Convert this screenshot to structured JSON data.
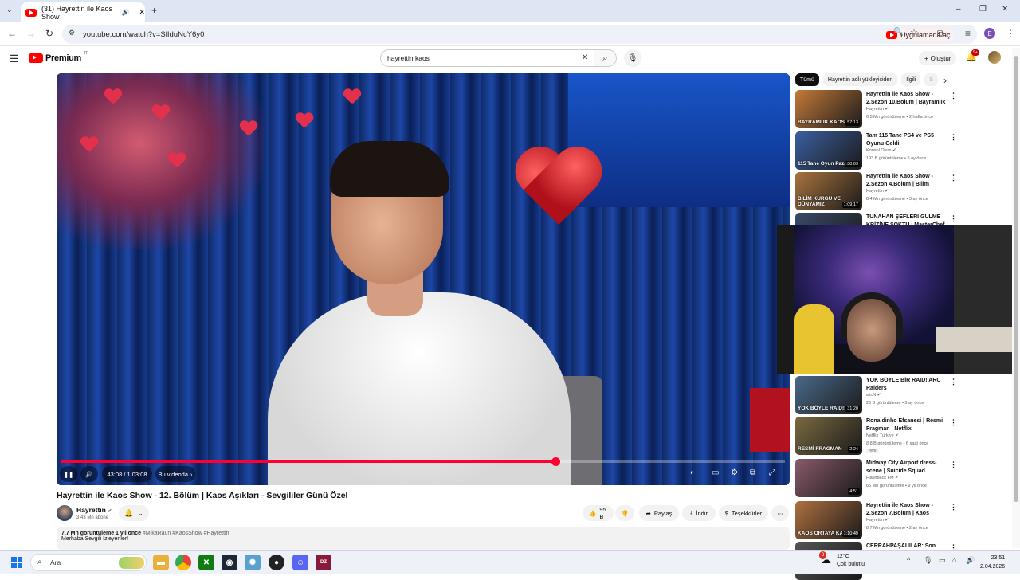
{
  "browser": {
    "tab_title": "(31) Hayrettin ile Kaos Show",
    "url": "youtube.com/watch?v=SlIduNcY6y0",
    "open_in_app": "Uygulamada aç"
  },
  "youtube": {
    "logo_text": "Premium",
    "logo_region": "TR",
    "search_value": "hayrettin kaos",
    "create_label": "Oluştur",
    "notification_count": "9+"
  },
  "player": {
    "time": "43:08 / 1:03:08",
    "chapter": "Bu videoda",
    "progress_fraction": 0.683
  },
  "video": {
    "title": "Hayrettin ile Kaos Show - 12. Bölüm | Kaos Aşıkları - Sevgililer Günü Özel",
    "channel": "Hayrettin",
    "subscribers": "3,43 Mn abone",
    "likes": "95 B",
    "share": "Paylaş",
    "download": "İndir",
    "thanks": "Teşekkürler",
    "views_date": "7,7 Mn görüntüleme  1 yıl önce",
    "tags": "#MikaRaun #KaosShow #Hayrettin",
    "description": "Merhaba Sevgili İzleyenler!"
  },
  "chips": [
    "Tümü",
    "Hayrettin adlı yükleyiciden",
    "İlgili",
    "S"
  ],
  "recommendations": [
    {
      "title": "Hayrettin ile Kaos Show - 2.Sezon 10.Bölüm | Bayramlık ...",
      "channel": "Hayrettin",
      "meta": "6,5 Mn görüntüleme • 2 hafta önce",
      "duration": "57:13",
      "thumb_text": "BAYRAMLIK KAOS",
      "thumb_color": "#c47a3a"
    },
    {
      "title": "Tam 115 Tane PS4 ve PS5 Oyunu Geldi",
      "channel": "Konsol Oyun",
      "meta": "193 B görüntüleme • 5 ay önce",
      "duration": "30:09",
      "thumb_text": "115 Tane Oyun Pazarı",
      "thumb_color": "#3a5fa0"
    },
    {
      "title": "Hayrettin ile Kaos Show - 2.Sezon 4.Bölüm | Bilim Kurgu...",
      "channel": "Hayrettin",
      "meta": "8,4 Mn görüntüleme • 3 ay önce",
      "duration": "1:09:17",
      "thumb_text": "BİLİM KURGU VE DÜNYAMIZ",
      "thumb_color": "#a8743e"
    },
    {
      "title": "TUNAHAN ŞEFLERİ GÜLME KRİZİNE SOKTU | MasterChef",
      "channel": "",
      "meta": "",
      "duration": "",
      "thumb_text": "",
      "thumb_color": "#3a4a6a"
    },
    {
      "title": "YOK BÖYLE BİR RAID! ARC Raiders",
      "channel": "wtcN",
      "meta": "23 B görüntüleme • 3 ay önce",
      "duration": "31:20",
      "thumb_text": "YOK BÖYLE RAID!!",
      "thumb_color": "#4a6a8a"
    },
    {
      "title": "Ronaldinho Efsanesi | Resmi Fragman | Netflix",
      "channel": "Netflix Türkiye",
      "meta": "8,8 B görüntüleme • 6 saat önce",
      "badge": "Yeni",
      "duration": "2:24",
      "thumb_text": "RESMİ FRAGMAN",
      "thumb_color": "#7a6a40"
    },
    {
      "title": "Midway City Airport dress-scene | Suicide Squad",
      "channel": "Flashback FM",
      "meta": "65 Mn görüntüleme • 9 yıl önce",
      "duration": "4:51",
      "thumb_text": "",
      "thumb_color": "#8a5a6a"
    },
    {
      "title": "Hayrettin ile Kaos Show - 2.Sezon 7.Bölüm | Kaos Ortay...",
      "channel": "Hayrettin",
      "meta": "8,7 Mn görüntüleme • 2 ay önce",
      "duration": "1:10:49",
      "thumb_text": "KAOS ORTAYA KARIŞIK",
      "thumb_color": "#b07040"
    },
    {
      "title": "CERRAHPAŞALILAR: Son Oyun -",
      "channel": "",
      "meta": "",
      "duration": "",
      "thumb_text": "",
      "thumb_color": "#555"
    }
  ],
  "taskbar": {
    "search_placeholder": "Ara",
    "weather_temp": "12°C",
    "weather_desc": "Çok bulutlu",
    "weather_badge": "2",
    "time": "23:51",
    "date": "2.04.2026"
  },
  "colors": {
    "youtube_red": "#ff0000",
    "progress_red": "#ff0033"
  }
}
